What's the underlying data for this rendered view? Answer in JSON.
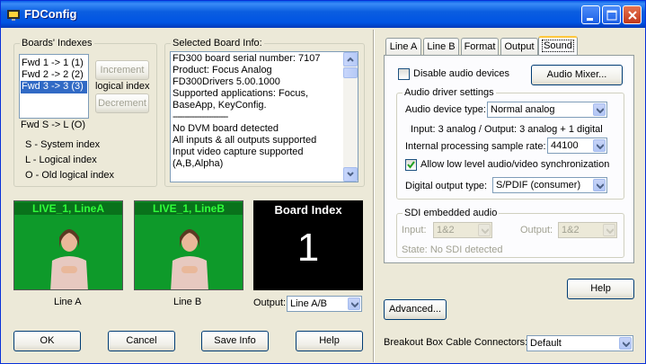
{
  "window": {
    "title": "FDConfig"
  },
  "boards": {
    "group_label": "Boards' Indexes",
    "items": [
      "Fwd 1 -> 1 (1)",
      "Fwd 2 -> 2 (2)",
      "Fwd 3 -> 3 (3)"
    ],
    "selected_index": 2,
    "increment_label": "Increment",
    "logical_index_label": "logical index",
    "decrement_label": "Decrement",
    "fwd_line": "Fwd S -> L (O)",
    "legend": [
      "S - System index",
      "L - Logical index",
      "O - Old logical index"
    ]
  },
  "board_info": {
    "group_label": "Selected Board Info:",
    "lines": [
      "FD300 board serial number: 7107",
      "Product: Focus Analog",
      "FD300Drivers 5.00.1000",
      "Supported applications: Focus,",
      "BaseApp, KeyConfig.",
      "-----------------------",
      "No DVM board detected",
      "All inputs & all outputs supported",
      "Input video capture supported",
      "(A,B,Alpha)"
    ]
  },
  "previews": {
    "line_a_overlay": "LIVE_1, LineA",
    "line_b_overlay": "LIVE_1, LineB",
    "line_a_caption": "Line A",
    "line_b_caption": "Line B",
    "board_index_title": "Board Index",
    "board_index_value": "1",
    "output_label": "Output:",
    "output_value": "Line A/B"
  },
  "bottom_buttons": {
    "ok": "OK",
    "cancel": "Cancel",
    "save_info": "Save Info",
    "help": "Help"
  },
  "tabs": [
    "Line A",
    "Line B",
    "Format",
    "Output",
    "Sound"
  ],
  "active_tab": 4,
  "sound": {
    "disable_audio_label": "Disable audio devices",
    "disable_audio_checked": false,
    "audio_mixer_label": "Audio Mixer...",
    "driver_group_label": "Audio driver settings",
    "device_type_label": "Audio device type:",
    "device_type_value": "Normal analog",
    "io_text": "Input: 3 analog / Output: 3 analog + 1 digital",
    "sample_rate_label": "Internal processing sample rate:",
    "sample_rate_value": "44100",
    "sync_label": "Allow low level audio/video synchronization",
    "sync_checked": true,
    "digital_output_label": "Digital output type:",
    "digital_output_value": "S/PDIF (consumer)",
    "sdi_group_label": "SDI embedded audio",
    "sdi_input_label": "Input:",
    "sdi_input_value": "1&2",
    "sdi_output_label": "Output:",
    "sdi_output_value": "1&2",
    "sdi_state_label": "State:",
    "sdi_state_value": "No SDI detected"
  },
  "right_buttons": {
    "help": "Help",
    "advanced": "Advanced..."
  },
  "breakout": {
    "label": "Breakout Box Cable Connectors:",
    "value": "Default"
  }
}
